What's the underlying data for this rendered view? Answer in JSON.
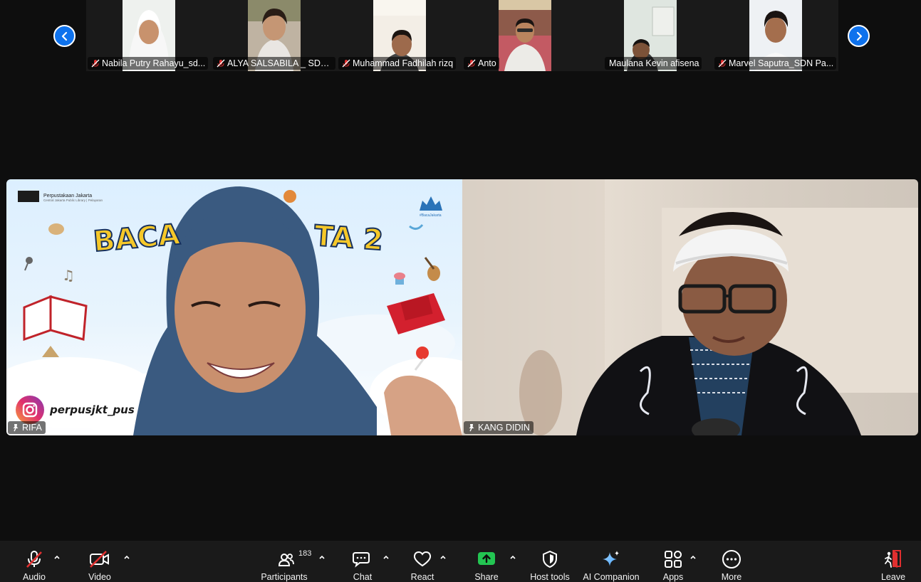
{
  "participants_strip": [
    {
      "name": "Nabila Putry Rahayu_sd...",
      "muted": true
    },
    {
      "name": "ALYA SALSABILA _ SDN P...",
      "muted": true
    },
    {
      "name": "Muhammad Fadhilah rizq",
      "muted": true
    },
    {
      "name": "Anto",
      "muted": true
    },
    {
      "name": "Maulana Kevin afisena",
      "muted": false
    },
    {
      "name": "Marvel Saputra_SDN Pa...",
      "muted": true
    }
  ],
  "main_videos": {
    "left": {
      "name": "RIFA",
      "overlay": {
        "org_name": "Perpustakaan Jakarta",
        "org_sub": "Central Jakarta Public Library | Pelayaran",
        "banner_left": "BACA",
        "banner_right": "TA 2",
        "hashtag": "#BacaJakarta",
        "instagram_handle": "perpusjkt_pus"
      }
    },
    "right": {
      "name": "KANG DIDIN"
    }
  },
  "toolbar": {
    "audio": "Audio",
    "video": "Video",
    "participants": "Participants",
    "participants_count": "183",
    "chat": "Chat",
    "react": "React",
    "share": "Share",
    "host_tools": "Host tools",
    "ai_companion": "AI Companion",
    "apps": "Apps",
    "more": "More",
    "leave": "Leave"
  },
  "colors": {
    "accent_blue": "#0e72ed",
    "share_green": "#23c552",
    "muted_red": "#e02f2f",
    "leave_red": "#e02f2f"
  }
}
